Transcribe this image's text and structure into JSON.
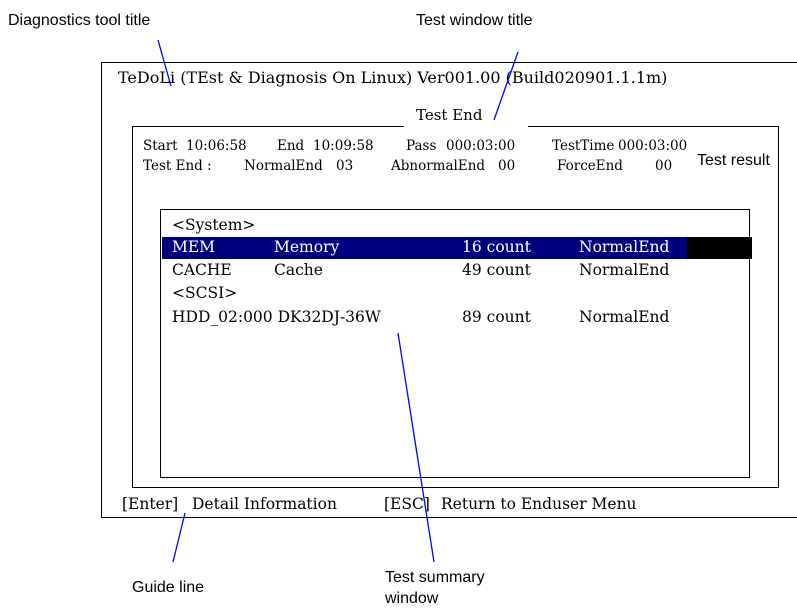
{
  "callouts": {
    "diagnostics_tool_title": "Diagnostics tool title",
    "test_window_title": "Test window title",
    "test_result": "Test result",
    "guide_line": "Guide line",
    "test_summary_window_line1": "Test summary",
    "test_summary_window_line2": "window"
  },
  "screen": {
    "tool_title": "TeDoLi (TEst & Diagnosis On Linux) Ver001.00 (Build020901.1.1m)",
    "window_title": "Test End",
    "result": {
      "start_label": "Start",
      "start_value": "10:06:58",
      "end_label": "End",
      "end_value": "10:09:58",
      "pass_label": "Pass",
      "pass_value": "000:03:00",
      "testtime_label": "TestTime",
      "testtime_value": "000:03:00",
      "testend_label": "Test End :",
      "normalend_label": "NormalEnd",
      "normalend_value": "03",
      "abnormalend_label": "AbnormalEnd",
      "abnormalend_value": "00",
      "forceend_label": "ForceEnd",
      "forceend_value": "00"
    },
    "summary": {
      "group_system": "<System>",
      "rows": [
        {
          "id": "MEM",
          "name": "Memory",
          "count": "16 count",
          "status": "NormalEnd",
          "selected": true
        },
        {
          "id": "CACHE",
          "name": "Cache",
          "count": "49 count",
          "status": "NormalEnd",
          "selected": false
        }
      ],
      "group_scsi": "<SCSI>",
      "hdd_row": {
        "device": "HDD_02:000 DK32DJ-36W",
        "count": "89 count",
        "status": "NormalEnd"
      }
    },
    "guide": {
      "enter_key": "[Enter]",
      "enter_action": "Detail Information",
      "esc_key": "[ESC]",
      "esc_action": "Return to Enduser Menu"
    }
  },
  "colors": {
    "selection_bar": "#00007f",
    "selection_tail": "#000000",
    "selection_text": "#ffffff"
  }
}
